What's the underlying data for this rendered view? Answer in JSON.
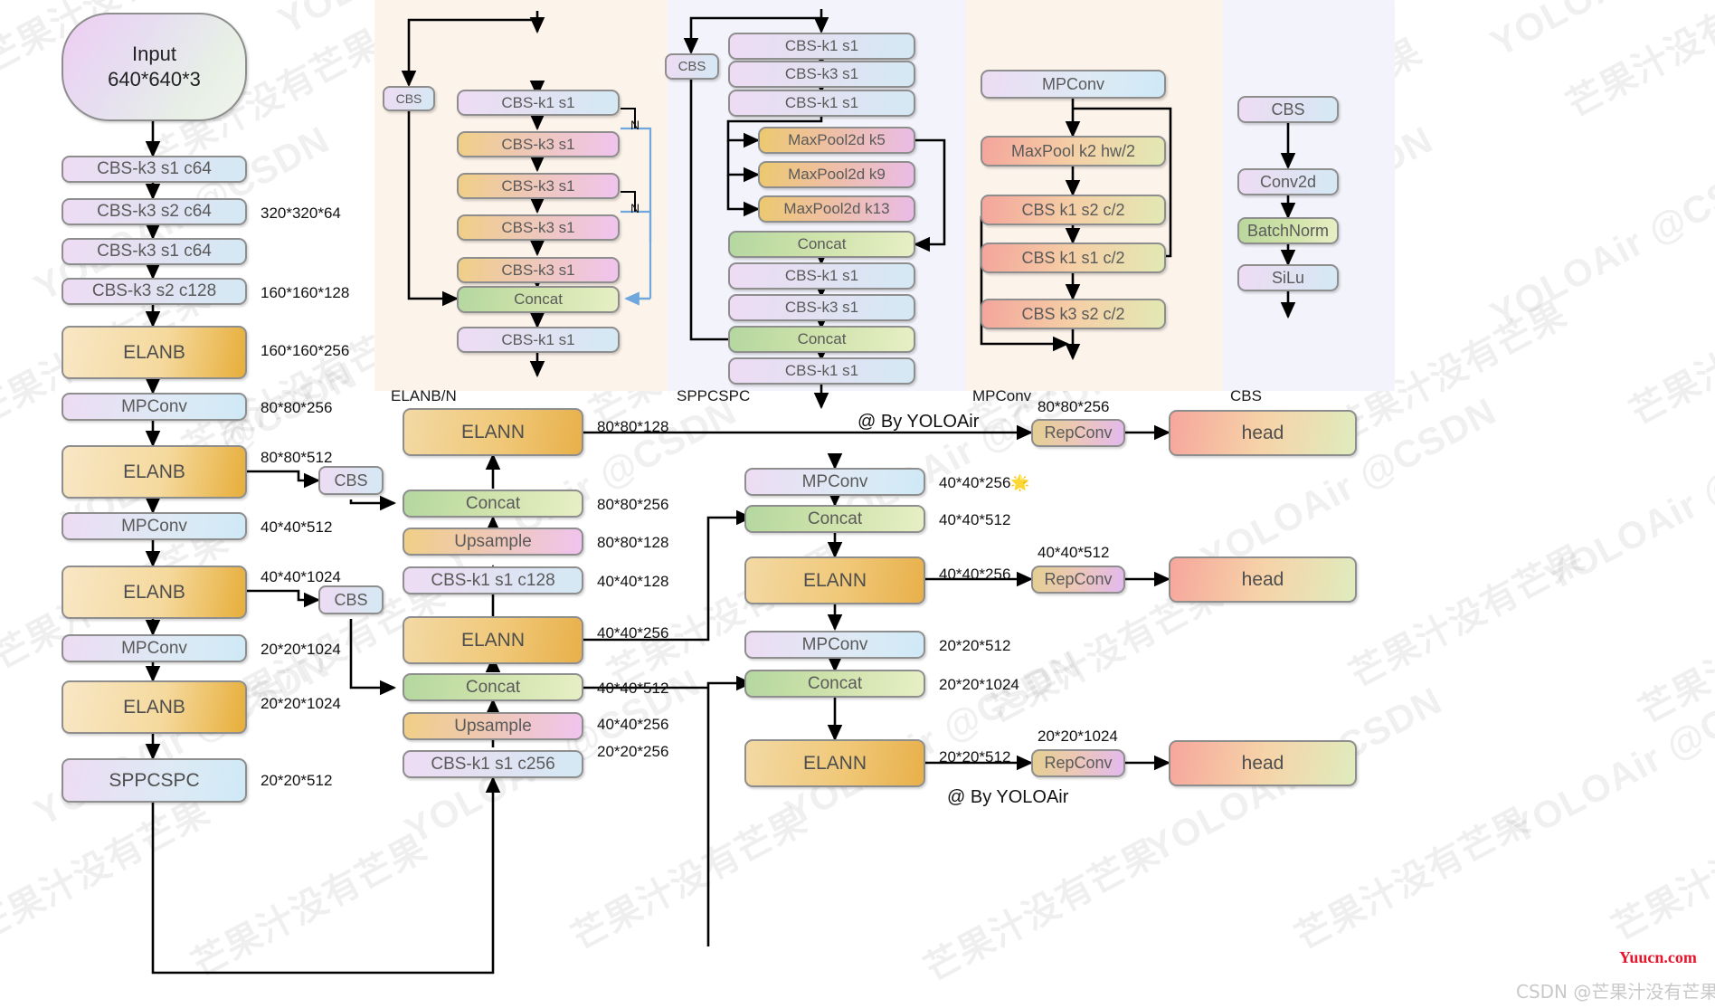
{
  "panels": [
    {
      "id": "elanb",
      "label": "ELANB/N",
      "bg": "#fcf3ea"
    },
    {
      "id": "sppcspc",
      "label": "SPPCSPC",
      "bg": "#f3f4fb"
    },
    {
      "id": "mpconv",
      "label": "MPConv",
      "bg": "#fcf3ea"
    },
    {
      "id": "cbs",
      "label": "CBS",
      "bg": "#f3f4fb"
    }
  ],
  "backbone": {
    "input": "Input\n640*640*3",
    "input_line1": "Input",
    "input_line2": "640*640*3",
    "nodes": [
      {
        "label": "CBS-k3 s1 c64",
        "dim": ""
      },
      {
        "label": "CBS-k3 s2 c64",
        "dim": "320*320*64"
      },
      {
        "label": "CBS-k3 s1 c64",
        "dim": ""
      },
      {
        "label": "CBS-k3 s2 c128",
        "dim": "160*160*128"
      },
      {
        "label": "ELANB",
        "dim": "160*160*256"
      },
      {
        "label": "MPConv",
        "dim": "80*80*256"
      },
      {
        "label": "ELANB",
        "dim": "80*80*512"
      },
      {
        "label": "MPConv",
        "dim": "40*40*512"
      },
      {
        "label": "ELANB",
        "dim": "40*40*1024"
      },
      {
        "label": "MPConv",
        "dim": "20*20*1024"
      },
      {
        "label": "ELANB",
        "dim": "20*20*1024"
      },
      {
        "label": "SPPCSPC",
        "dim": "20*20*512"
      }
    ],
    "cbs_tap_1": "CBS",
    "cbs_tap_2": "CBS"
  },
  "elanb_module": {
    "title": "ELANB/N",
    "side_cbs": "CBS",
    "n_label_1": "N",
    "n_label_2": "N",
    "nodes": [
      {
        "label": "CBS-k1 s1",
        "style": "g-cbs"
      },
      {
        "label": "CBS-k3 s1",
        "style": "g-cbsk3"
      },
      {
        "label": "CBS-k3 s1",
        "style": "g-cbsk3"
      },
      {
        "label": "CBS-k3 s1",
        "style": "g-cbsk3"
      },
      {
        "label": "CBS-k3 s1",
        "style": "g-cbsk3"
      },
      {
        "label": "Concat",
        "style": "g-cat"
      },
      {
        "label": "CBS-k1 s1",
        "style": "g-cbs"
      }
    ]
  },
  "sppcspc_module": {
    "title": "SPPCSPC",
    "side_cbs": "CBS",
    "nodes": [
      {
        "label": "CBS-k1 s1",
        "style": "g-cbs"
      },
      {
        "label": "CBS-k3 s1",
        "style": "g-cbs"
      },
      {
        "label": "CBS-k1 s1",
        "style": "g-cbs"
      },
      {
        "label": "MaxPool2d k5",
        "style": "g-pool"
      },
      {
        "label": "MaxPool2d k9",
        "style": "g-pool"
      },
      {
        "label": "MaxPool2d k13",
        "style": "g-pool"
      },
      {
        "label": "Concat",
        "style": "g-cat"
      },
      {
        "label": "CBS-k1 s1",
        "style": "g-cbs"
      },
      {
        "label": "CBS-k3 s1",
        "style": "g-cbs"
      },
      {
        "label": "Concat",
        "style": "g-cat"
      },
      {
        "label": "CBS-k1 s1",
        "style": "g-cbs"
      }
    ]
  },
  "mpconv_module": {
    "title": "MPConv",
    "nodes": [
      {
        "label": "MPConv",
        "style": "g-mp"
      },
      {
        "label": "MaxPool k2 hw/2",
        "style": "g-poolr"
      },
      {
        "label": "CBS k1 s2 c/2",
        "style": "g-poolr"
      },
      {
        "label": "CBS k1 s1 c/2",
        "style": "g-poolr"
      },
      {
        "label": "CBS k3 s2 c/2",
        "style": "g-poolr"
      }
    ]
  },
  "cbs_module": {
    "title": "CBS",
    "nodes": [
      {
        "label": "CBS",
        "style": "g-cbs"
      },
      {
        "label": "Conv2d",
        "style": "g-cbs"
      },
      {
        "label": "BatchNorm",
        "style": "g-bn"
      },
      {
        "label": "SiLu",
        "style": "g-cbs"
      }
    ]
  },
  "neck": {
    "nodes": [
      {
        "label": "ELANN",
        "dim": "80*80*128",
        "style": "g-elanc"
      },
      {
        "label": "Concat",
        "dim": "80*80*256",
        "style": "g-cat"
      },
      {
        "label": "Upsample",
        "dim": "80*80*128",
        "style": "g-up"
      },
      {
        "label": "CBS-k1 s1 c128",
        "dim": "40*40*128",
        "style": "g-cbs"
      },
      {
        "label": "ELANN",
        "dim": "40*40*256",
        "style": "g-elanc"
      },
      {
        "label": "Concat",
        "dim": "40*40*512",
        "style": "g-cat"
      },
      {
        "label": "Upsample",
        "dim": "40*40*256",
        "style": "g-up"
      },
      {
        "label": "CBS-k1 s1 c256",
        "dim": "20*20*256",
        "style": "g-cbs"
      }
    ]
  },
  "head_path": {
    "nodes": [
      {
        "label": "MPConv",
        "dim": "40*40*256🌟",
        "style": "g-mp"
      },
      {
        "label": "Concat",
        "dim": "40*40*512",
        "style": "g-cat"
      },
      {
        "label": "ELANN",
        "dim": "40*40*256",
        "style": "g-elanc"
      },
      {
        "label": "MPConv",
        "dim": "20*20*512",
        "style": "g-mp"
      },
      {
        "label": "Concat",
        "dim": "20*20*1024",
        "style": "g-cat"
      },
      {
        "label": "ELANN",
        "dim": "20*20*512",
        "style": "g-elanc"
      }
    ]
  },
  "outputs": [
    {
      "repconv": "RepConv",
      "head": "head",
      "dim": "80*80*256"
    },
    {
      "repconv": "RepConv",
      "head": "head",
      "dim": "40*40*512"
    },
    {
      "repconv": "RepConv",
      "head": "head",
      "dim": "20*20*1024"
    }
  ],
  "credits": {
    "by_top": "@ By YOLOAir",
    "by_bottom": "@ By YOLOAir",
    "site": "Yuucn.com",
    "csdn": "CSDN @芒果汁没有芒果"
  },
  "watermarks": {
    "latin": "YOLOAir  @CSDN",
    "cn": "芒果汁没有芒果"
  },
  "colors": {
    "accent_red": "#e8142b",
    "panel_warm": "#fcf3ea",
    "panel_cool": "#f3f4fb",
    "node_border": "#8e8e8e",
    "n_bracket": "#6fa8dc"
  }
}
